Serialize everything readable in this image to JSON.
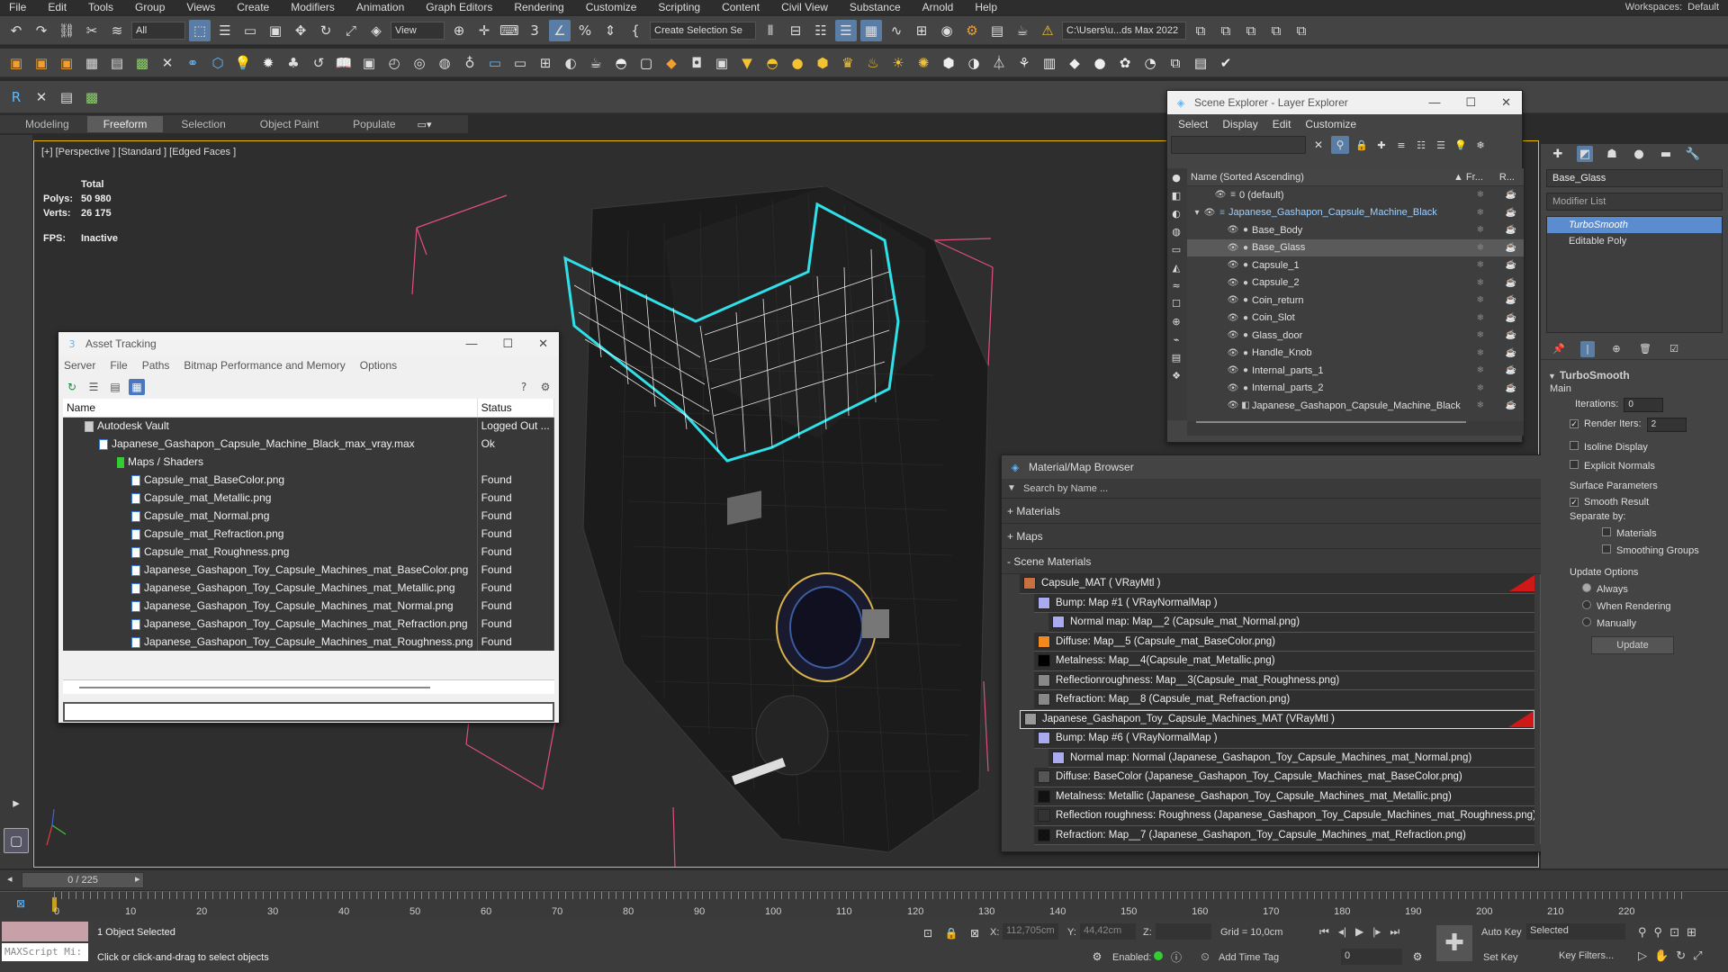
{
  "menubar": {
    "items": [
      "File",
      "Edit",
      "Tools",
      "Group",
      "Views",
      "Create",
      "Modifiers",
      "Animation",
      "Graph Editors",
      "Rendering",
      "Customize",
      "Scripting",
      "Content",
      "Civil View",
      "Substance",
      "Arnold",
      "Help"
    ],
    "workspaces_label": "Workspaces:",
    "workspace": "Default"
  },
  "toolbar": {
    "filter_combo": "All",
    "view_combo": "View",
    "selection_set": "Create Selection Se",
    "path_combo": "C:\\Users\\u...ds Max 2022"
  },
  "ribbon": {
    "tabs": [
      "Modeling",
      "Freeform",
      "Selection",
      "Object Paint",
      "Populate"
    ],
    "selected": "Freeform"
  },
  "viewport": {
    "label": "[+] [Perspective ] [Standard ] [Edged Faces ]",
    "stats": {
      "total": "Total",
      "polys_label": "Polys:",
      "polys": "50 980",
      "verts_label": "Verts:",
      "verts": "26 175",
      "fps_label": "FPS:",
      "fps": "Inactive"
    }
  },
  "asset_tracking": {
    "title": "Asset Tracking",
    "menu": [
      "Server",
      "File",
      "Paths",
      "Bitmap Performance and Memory",
      "Options"
    ],
    "col_name": "Name",
    "col_status": "Status",
    "rows": [
      {
        "name": "Autodesk Vault",
        "status": "Logged Out ..."
      },
      {
        "name": "Japanese_Gashapon_Capsule_Machine_Black_max_vray.max",
        "status": "Ok"
      },
      {
        "name": "Maps / Shaders",
        "status": ""
      },
      {
        "name": "Capsule_mat_BaseColor.png",
        "status": "Found"
      },
      {
        "name": "Capsule_mat_Metallic.png",
        "status": "Found"
      },
      {
        "name": "Capsule_mat_Normal.png",
        "status": "Found"
      },
      {
        "name": "Capsule_mat_Refraction.png",
        "status": "Found"
      },
      {
        "name": "Capsule_mat_Roughness.png",
        "status": "Found"
      },
      {
        "name": "Japanese_Gashapon_Toy_Capsule_Machines_mat_BaseColor.png",
        "status": "Found"
      },
      {
        "name": "Japanese_Gashapon_Toy_Capsule_Machines_mat_Metallic.png",
        "status": "Found"
      },
      {
        "name": "Japanese_Gashapon_Toy_Capsule_Machines_mat_Normal.png",
        "status": "Found"
      },
      {
        "name": "Japanese_Gashapon_Toy_Capsule_Machines_mat_Refraction.png",
        "status": "Found"
      },
      {
        "name": "Japanese_Gashapon_Toy_Capsule_Machines_mat_Roughness.png",
        "status": "Found"
      }
    ]
  },
  "scene_explorer": {
    "title": "Scene Explorer - Layer Explorer",
    "menu": [
      "Select",
      "Display",
      "Edit",
      "Customize"
    ],
    "col_name": "Name (Sorted Ascending)",
    "col_fr": "▲ Fr...",
    "col_r": "R...",
    "rows": [
      {
        "name": "0 (default)"
      },
      {
        "name": "Japanese_Gashapon_Capsule_Machine_Black"
      },
      {
        "name": "Base_Body"
      },
      {
        "name": "Base_Glass"
      },
      {
        "name": "Capsule_1"
      },
      {
        "name": "Capsule_2"
      },
      {
        "name": "Coin_return"
      },
      {
        "name": "Coin_Slot"
      },
      {
        "name": "Glass_door"
      },
      {
        "name": "Handle_Knob"
      },
      {
        "name": "Internal_parts_1"
      },
      {
        "name": "Internal_parts_2"
      },
      {
        "name": "Japanese_Gashapon_Capsule_Machine_Black"
      }
    ],
    "selected": "Base_Glass"
  },
  "material_browser": {
    "title": "Material/Map Browser",
    "search_placeholder": "Search by Name ...",
    "groups": [
      "+ Materials",
      "+ Maps",
      "- Scene Materials"
    ],
    "rows": [
      {
        "text": "Capsule_MAT  ( VRayMtl )",
        "color": "#c87040"
      },
      {
        "text": "Bump: Map #1  ( VRayNormalMap )",
        "color": "#aaaaee"
      },
      {
        "text": "Normal map: Map__2 (Capsule_mat_Normal.png)",
        "color": "#aaaaee"
      },
      {
        "text": "Diffuse: Map__5 (Capsule_mat_BaseColor.png)",
        "color": "#f08a20"
      },
      {
        "text": "Metalness: Map__4(Capsule_mat_Metallic.png)",
        "color": "#000000"
      },
      {
        "text": "Reflectionroughness: Map__3(Capsule_mat_Roughness.png)",
        "color": "#888888"
      },
      {
        "text": "Refraction: Map__8 (Capsule_mat_Refraction.png)",
        "color": "#888888"
      },
      {
        "text": "Japanese_Gashapon_Toy_Capsule_Machines_MAT (VRayMtl )",
        "color": "#999999"
      },
      {
        "text": "Bump: Map #6  ( VRayNormalMap )",
        "color": "#aaaaee"
      },
      {
        "text": "Normal map: Normal (Japanese_Gashapon_Toy_Capsule_Machines_mat_Normal.png)",
        "color": "#aaaaee"
      },
      {
        "text": "Diffuse: BaseColor (Japanese_Gashapon_Toy_Capsule_Machines_mat_BaseColor.png)",
        "color": "#555555"
      },
      {
        "text": "Metalness: Metallic (Japanese_Gashapon_Toy_Capsule_Machines_mat_Metallic.png)",
        "color": "#111111"
      },
      {
        "text": "Reflection roughness: Roughness (Japanese_Gashapon_Toy_Capsule_Machines_mat_Roughness.png)",
        "color": "#333333"
      },
      {
        "text": "Refraction: Map__7 (Japanese_Gashapon_Toy_Capsule_Machines_mat_Refraction.png)",
        "color": "#111111"
      }
    ]
  },
  "command_panel": {
    "object_name": "Base_Glass",
    "modifier_list": "Modifier List",
    "stack": [
      "TurboSmooth",
      "Editable Poly"
    ],
    "rollout": "TurboSmooth",
    "main": "Main",
    "iterations_label": "Iterations:",
    "iterations": "0",
    "render_iters_label": "Render Iters:",
    "render_iters": "2",
    "isoline": "Isoline Display",
    "explicit": "Explicit Normals",
    "surface_params": "Surface Parameters",
    "smooth_result": "Smooth Result",
    "separate_by": "Separate by:",
    "materials": "Materials",
    "smoothing_groups": "Smoothing Groups",
    "update_options": "Update Options",
    "always": "Always",
    "when_rendering": "When Rendering",
    "manually": "Manually",
    "update_btn": "Update"
  },
  "timeline": {
    "frame": "0 / 225",
    "ticks": [
      "0",
      "10",
      "20",
      "30",
      "40",
      "50",
      "60",
      "70",
      "80",
      "90",
      "100",
      "110",
      "120",
      "130",
      "140",
      "150",
      "160",
      "170",
      "180",
      "190",
      "200",
      "210",
      "220"
    ]
  },
  "status": {
    "maxscript": "MAXScript Mi:",
    "selected": "1 Object Selected",
    "hint": "Click or click-and-drag to select objects",
    "x_label": "X:",
    "x": "112,705cm",
    "y_label": "Y:",
    "y": "44,42cm",
    "z_label": "Z:",
    "grid": "Grid = 10,0cm",
    "enabled": "Enabled:",
    "add_time_tag": "Add Time Tag",
    "autokey": "Auto Key",
    "setkey": "Set Key",
    "selected_combo": "Selected",
    "key_filters": "Key Filters...",
    "frame_field": "0"
  },
  "colors": {
    "accent": "#5b8ccf",
    "viewport_border": "#f0c000",
    "wire_cyan": "#30e0e8"
  }
}
